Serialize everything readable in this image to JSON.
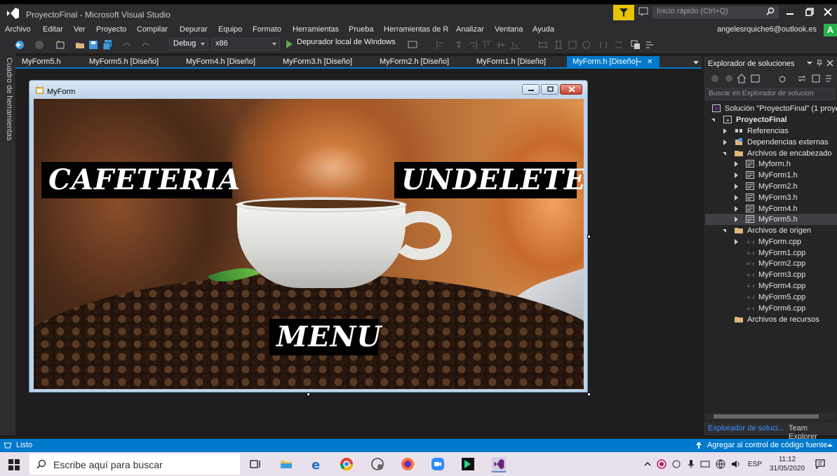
{
  "window": {
    "title": "ProyectoFinal - Microsoft Visual Studio",
    "quick_launch_placeholder": "Inicio rápido (Ctrl+Q)"
  },
  "menu": [
    "Archivo",
    "Editar",
    "Ver",
    "Proyecto",
    "Compilar",
    "Depurar",
    "Equipo",
    "Formato",
    "Herramientas",
    "Prueba",
    "Herramientas de R",
    "Analizar",
    "Ventana",
    "Ayuda"
  ],
  "account": {
    "email": "angelesrquiche6@outlook.es",
    "initial": "A"
  },
  "toolbar": {
    "config": "Debug",
    "platform": "x86",
    "run_label": "Depurador local de Windows"
  },
  "toolbox_label": "Cuadro de herramientas",
  "tabs": [
    "MyForm5.h",
    "MyForm5.h [Diseño]",
    "MyForm4.h [Diseño]",
    "MyForm3.h [Diseño]",
    "MyForm2.h [Diseño]",
    "MyForm1.h [Diseño]",
    "MyForm.h [Diseño]"
  ],
  "active_tab_index": 6,
  "form": {
    "title": "MyForm",
    "labels": {
      "cafeteria": "CAFETERIA",
      "undelete": "UNDELETE",
      "menu": "MENU"
    }
  },
  "solution_explorer": {
    "title": "Explorador de soluciones",
    "search_placeholder": "Buscar en Explorador de solucion",
    "tree": [
      {
        "label": "Solución \"ProyectoFinal\" (1 proye",
        "icon": "solution-icon"
      },
      {
        "label": "ProyectoFinal",
        "icon": "project-icon"
      },
      {
        "label": "Referencias",
        "icon": "references-icon"
      },
      {
        "label": "Dependencias externas",
        "icon": "external-deps-icon"
      },
      {
        "label": "Archivos de encabezado",
        "icon": "folder-icon"
      },
      {
        "label": "Myform.h",
        "icon": "form-file-icon"
      },
      {
        "label": "MyForm1.h",
        "icon": "form-file-icon"
      },
      {
        "label": "MyForm2.h",
        "icon": "form-file-icon"
      },
      {
        "label": "MyForm3.h",
        "icon": "form-file-icon"
      },
      {
        "label": "MyForm4.h",
        "icon": "form-file-icon"
      },
      {
        "label": "MyForm5.h",
        "icon": "form-file-icon"
      },
      {
        "label": "Archivos de origen",
        "icon": "folder-icon"
      },
      {
        "label": "MyForm.cpp",
        "icon": "cpp-file-icon"
      },
      {
        "label": "MyForm1.cpp",
        "icon": "cpp-file-icon"
      },
      {
        "label": "MyForm2.cpp",
        "icon": "cpp-file-icon"
      },
      {
        "label": "MyForm3.cpp",
        "icon": "cpp-file-icon"
      },
      {
        "label": "MyForm4.cpp",
        "icon": "cpp-file-icon"
      },
      {
        "label": "MyForm5.cpp",
        "icon": "cpp-file-icon"
      },
      {
        "label": "MyForm6.cpp",
        "icon": "cpp-file-icon"
      },
      {
        "label": "Archivos de recursos",
        "icon": "folder-icon"
      }
    ],
    "bottom_tabs": [
      "Explorador de soluci...",
      "Team Explorer"
    ]
  },
  "status": {
    "left": "Listo",
    "right": "Agregar al control de código fuente"
  },
  "taskbar": {
    "search_placeholder": "Escribe aquí para buscar",
    "language": "ESP",
    "time": "11:12",
    "date": "31/05/2020"
  },
  "colors": {
    "accent": "#007acc",
    "vs_purple": "#68217a",
    "filter_yellow": "#e8c400",
    "avatar_green": "#27b34b"
  }
}
